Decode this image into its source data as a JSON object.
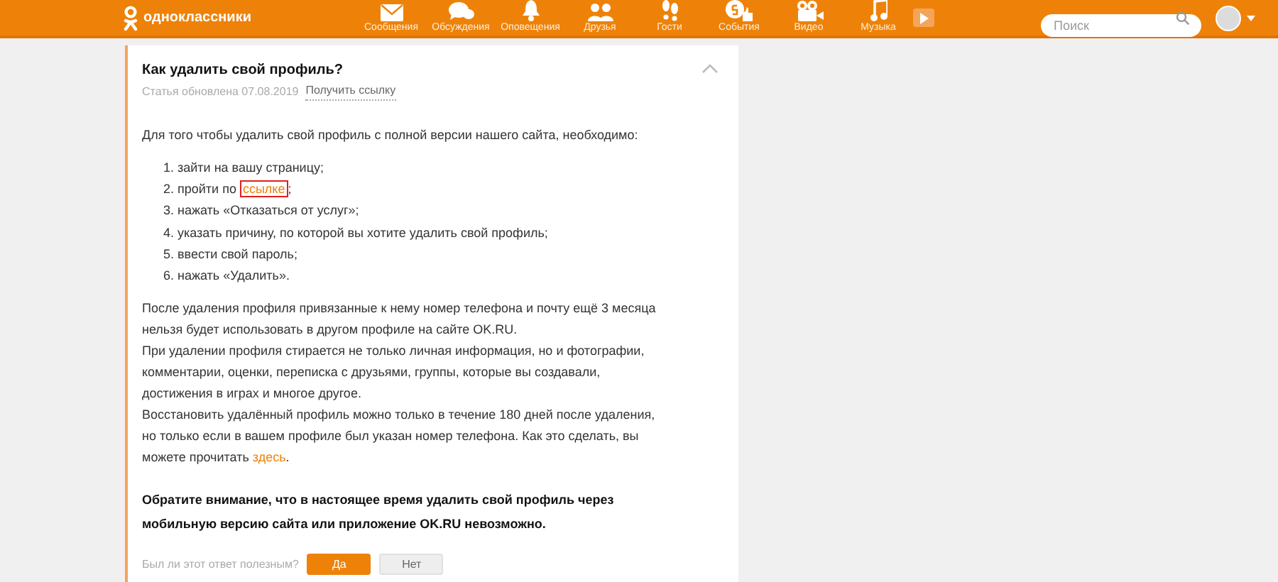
{
  "header": {
    "logo_text": "одноклассники",
    "nav": [
      {
        "kind": "messages",
        "label": "Сообщения"
      },
      {
        "kind": "discussions",
        "label": "Обсуждения"
      },
      {
        "kind": "notifications",
        "label": "Оповещения"
      },
      {
        "kind": "friends",
        "label": "Друзья"
      },
      {
        "kind": "guests",
        "label": "Гости"
      },
      {
        "kind": "events",
        "label": "События"
      },
      {
        "kind": "video",
        "label": "Видео"
      },
      {
        "kind": "music",
        "label": "Музыка"
      }
    ],
    "search": {
      "placeholder": "Поиск"
    }
  },
  "article": {
    "title": "Как удалить свой профиль?",
    "updated": "Статья обновлена 07.08.2019",
    "get_link": "Получить ссылку",
    "intro": "Для того чтобы удалить свой профиль с полной версии нашего сайта, необходимо:",
    "steps": [
      {
        "number": "1.",
        "text": "зайти на вашу страницу;"
      },
      {
        "number": "2.",
        "text": "пройти по ",
        "link": "ссылке",
        "after": ";",
        "highlighted": true
      },
      {
        "number": "3.",
        "text": "нажать «Отказаться от услуг»;"
      },
      {
        "number": "4.",
        "text": "указать причину, по которой вы хотите удалить свой профиль;"
      },
      {
        "number": "5.",
        "text": "ввести свой пароль;"
      },
      {
        "number": "6.",
        "text": "нажать «Удалить»."
      }
    ],
    "paragraphs": [
      {
        "text": "После удаления профиля привязанные к нему номер телефона и почту ещё 3 месяца нельзя будет использовать в другом профиле на сайте OK.RU."
      },
      {
        "text": "При удалении профиля стирается не только личная информация, но и фотографии, комментарии, оценки, переписка с друзьями, группы, которые вы создавали, достижения в играх и многое другое."
      },
      {
        "text": "Восстановить удалённый профиль можно только в течение 180 дней после удаления, но только если в вашем профиле был указан номер телефона. Как это сделать, вы можете прочитать ",
        "link": "здесь",
        "after": "."
      }
    ],
    "notice": "Обратите внимание, что в настоящее время удалить свой профиль через мобильную версию сайта или приложение OK.RU невозможно.",
    "feedback": {
      "question": "Был ли этот ответ полезным?",
      "buttons": [
        {
          "label": "Да",
          "primary": true
        },
        {
          "label": "Нет",
          "primary": false
        }
      ]
    }
  }
}
